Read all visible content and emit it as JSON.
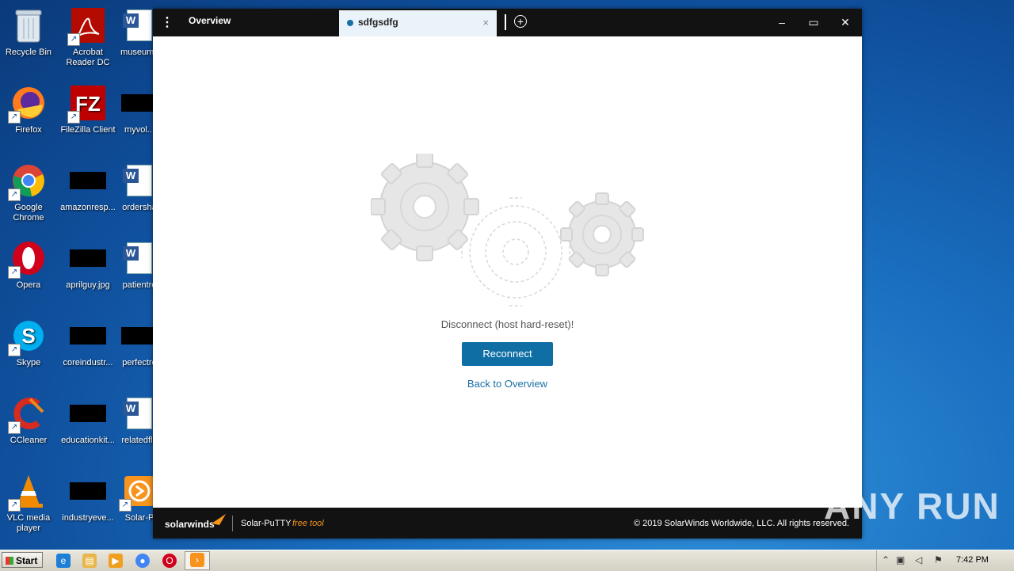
{
  "desktop": {
    "icons": [
      {
        "label": "Recycle Bin"
      },
      {
        "label": "Acrobat Reader DC"
      },
      {
        "label": "museumy"
      },
      {
        "label": "Firefox"
      },
      {
        "label": "FileZilla Client"
      },
      {
        "label": "myvol..."
      },
      {
        "label": "Google Chrome"
      },
      {
        "label": "amazonresp..."
      },
      {
        "label": "ordersha"
      },
      {
        "label": "Opera"
      },
      {
        "label": "aprilguy.jpg"
      },
      {
        "label": "patientre"
      },
      {
        "label": "Skype"
      },
      {
        "label": "coreindustr..."
      },
      {
        "label": "perfectre"
      },
      {
        "label": "CCleaner"
      },
      {
        "label": "educationkit..."
      },
      {
        "label": "relatedfle"
      },
      {
        "label": "VLC media player"
      },
      {
        "label": "industryeve..."
      },
      {
        "label": "Solar-P"
      }
    ]
  },
  "window": {
    "menu_icon": "⋮",
    "tabs": [
      {
        "label": "Overview"
      },
      {
        "label": "sdfgsdfg",
        "close": "×"
      }
    ],
    "add_tab_icon": "+",
    "controls": {
      "minimize": "–",
      "maximize": "▭",
      "close": "✕"
    }
  },
  "main": {
    "message": "Disconnect (host hard-reset)!",
    "reconnect_label": "Reconnect",
    "back_link": "Back to Overview"
  },
  "footer": {
    "brand": "solarwinds",
    "product": "Solar-PuTTY",
    "free_tool": "free tool",
    "copyright": "© 2019 SolarWinds Worldwide, LLC. All rights reserved."
  },
  "watermark": "ANY RUN",
  "taskbar": {
    "start_label": "Start",
    "clock": "7:42 PM"
  },
  "colors": {
    "accent": "#0f6fa5",
    "titlebar": "#121212",
    "brand_orange": "#f7941d"
  }
}
